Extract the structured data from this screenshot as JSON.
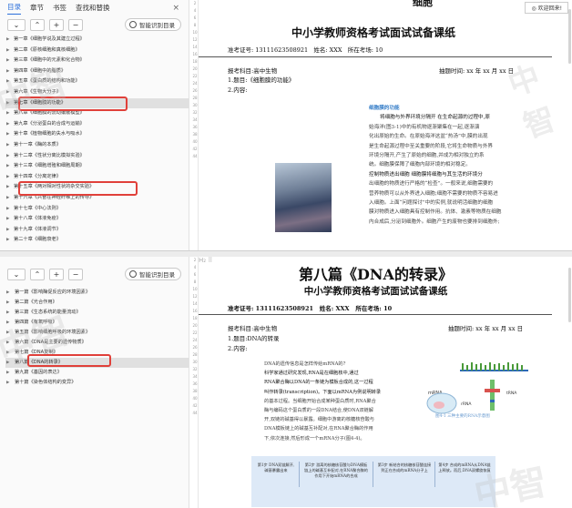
{
  "top": {
    "sidebar": {
      "tabs": [
        "目录",
        "章节",
        "书签",
        "查找和替换"
      ],
      "close": "×",
      "toolbar": {
        "collapse": "⌄",
        "expand": "⌃",
        "add": "+",
        "remove": "−",
        "smart_toc": "智能识别目录"
      },
      "items": [
        "第一章《细胞学说及其建立过程》",
        "第二章《原核细胞和真核细胞》",
        "第三章《细胞中的元素和化合物》",
        "第四章《细胞中的脂质》",
        "第五章《蛋白质的结构和功能》",
        "第六章《生物大分子》",
        "第七章《细胞膜的功能》",
        "第八章《细胞膜的流动镶嵌模型》",
        "第九章《分泌蛋白的合成与运输》",
        "第十章《植物细胞的失水与吸水》",
        "第十一章《酶的本质》",
        "第十二章《性状分离比模拟实验》",
        "第十三章《细胞增殖和细胞周期》",
        "第十四章《分离定律》",
        "第十五章《两对相对性状的杂交实验》",
        "第十六章《兴奋在神经纤维上的传导》",
        "第十七章《中心法则》",
        "第十八章《体液免疫》",
        "第十九章《体液调节》",
        "第二十章《细胞衰老》"
      ],
      "selected_index": 6,
      "highlight_index_a": 6,
      "highlight_index_b": 14
    },
    "doc": {
      "partial_title": "细胞",
      "welcome": "欢迎回来!",
      "title": "中小学教师资格考试面试试备课纸",
      "exam_no_label": "准考证号:",
      "exam_no": "13111623508921",
      "name_label": "姓名:",
      "name": "XXX",
      "site_label": "所在考场:",
      "site": "10",
      "subject_line": "报考科目:高中生物",
      "date_line": "抽题时间: xx 年 xx 月 xx 日",
      "topic_line": "1.题目:《细胞膜的功能》",
      "content_line": "2.内容:",
      "para_heading": "细胞膜的功能",
      "para_lines": [
        "将细胞与外界环境分隔开  在生命起源的过程中,原",
        "始海洋(图3-1)中的有机物逐渐聚集在一起,逐渐演",
        "化出原始的生命。在原始海洋这盆“热汤”中,膜的出现",
        "是生命起源过程中至关重要的阶段,它将生命物质与外界",
        "环境分隔开,产生了原始的细胞,并成为相对独立的系",
        "统。细胞膜保障了细胞内部环境的相对稳定。",
        "控制物质进出细胞  细胞膜将细胞与其生活的环境分",
        "出细胞的物质进行严格的“检查”。一般来说,细胞需要的",
        "营养物质可以从外界进入细胞;细胞不需要的物质不容易进",
        "入细胞。上面“问题探讨”中的实例,就说明活细胞的细胞",
        "膜对物质进入细胞具有控制作用。抗体、激素等物质在细胞",
        "内合成后,分泌到细胞外。细胞产生的废物也要排到细胞外;"
      ]
    }
  },
  "bottom": {
    "sidebar": {
      "toolbar": {
        "collapse": "⌄",
        "expand": "⌃",
        "add": "+",
        "remove": "−",
        "smart_toc": "智能识别目录"
      },
      "items": [
        "第一篇《影响酶促反应的环境因素》",
        "第二篇《光合作用》",
        "第三篇《生态系统的能量流动》",
        "第四篇《有氧呼吸》",
        "第五篇《影响细胞呼吸的环境因素》",
        "第六篇《DNA是主要的遗传物质》",
        "第七篇《DNA复制》",
        "第八篇《DNA的转录》",
        "第九篇《基因的表达》",
        "第十篇《染色体结构的变异》"
      ],
      "selected_index": 7,
      "highlight_index": 7
    },
    "doc": {
      "hb": "H₂ ⠿",
      "big_title": "第八篇《DNA的转录》",
      "title": "中小学教师资格考试面试试备课纸",
      "exam_no_label": "准考证号:",
      "exam_no": "13111623508921",
      "name_label": "姓名:",
      "name": "XXX",
      "site_label": "所在考场:",
      "site": "10",
      "subject_line": "报考科目:高中生物",
      "date_line": "抽题时间: xx 年 xx 月 xx 日",
      "topic_line": "1.题目:DNA的转录",
      "content_line": "2.内容:",
      "para_lines": [
        "DNA的遗传信息是怎样传给mRNA的?",
        "科学家通过研究发现,RNA是在细胞核中,通过",
        "RNA聚合酶以DNA的一条链为模板合成的,这一过程",
        "叫作转录(transcription)。下面以mRNA为例说明转录",
        "的基本过程。当细胞开始合成某种蛋白质时,RNA聚合",
        "酶与编码这个蛋白质的一段DNA结合,使DNA双链解",
        "开,双链的碱基得以暴露。细胞中游离的核糖核苷酸与",
        "DNA模板链上的碱基互补配对,在RNA聚合酶的作用",
        "下,依次连接,然后形成一个mRNA分子(图4-4)。"
      ],
      "fig_caption": "图4-1  三种主要的RNA示意图",
      "fig_labels": {
        "mrna": "mRNA",
        "trna": "tRNA",
        "rrna": "rRNA"
      },
      "box_cells": [
        "第1步 DNA双链解开,碱基暴露出来",
        "第2步 游离的核糖核苷酸与DNA模板链上的碱基互补配对,在RNA聚合酶的作用下开始mRNA的合成",
        "第3步 新结合的核糖核苷酸连接到正在合成的mRNA分子上",
        "第4步 合成的mRNA从DNA链上释放。而后,DNA双螺旋恢复"
      ]
    }
  },
  "watermark": "中智"
}
